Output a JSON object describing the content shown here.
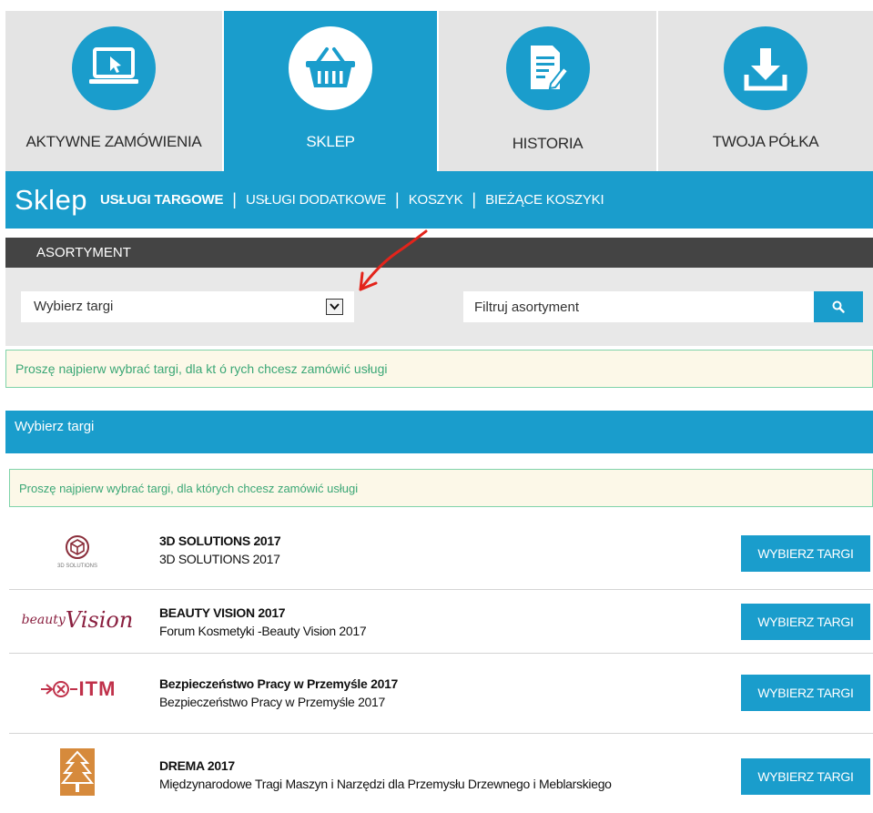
{
  "tiles": [
    {
      "label": "AKTYWNE ZAMÓWIENIA",
      "icon": "laptop-icon",
      "active": false
    },
    {
      "label": "SKLEP",
      "icon": "basket-icon",
      "active": true
    },
    {
      "label": "HISTORIA",
      "icon": "document-edit-icon",
      "active": false
    },
    {
      "label": "TWOJA PÓŁKA",
      "icon": "download-icon",
      "active": false
    }
  ],
  "shop_nav": {
    "title": "Sklep",
    "items": [
      {
        "label": "USŁUGI TARGOWE",
        "active": true
      },
      {
        "label": "USŁUGI DODATKOWE",
        "active": false
      },
      {
        "label": "KOSZYK",
        "active": false
      },
      {
        "label": "BIEŻĄCE KOSZYKI",
        "active": false
      }
    ],
    "separator": "|"
  },
  "assortment": {
    "heading": "ASORTYMENT",
    "select_value": "Wybierz targi",
    "filter_placeholder": "Filtruj asortyment"
  },
  "notice_top": "Proszę najpierw wybrać targi, dla kt ó rych chcesz zamówić usługi",
  "fair_section": {
    "heading": "Wybierz targi",
    "notice": "Proszę najpierw wybrać targi, dla których chcesz zamówić usługi",
    "button_label": "WYBIERZ TARGI",
    "fairs": [
      {
        "name": "3D SOLUTIONS 2017",
        "subtitle": "3D SOLUTIONS 2017",
        "logo_text": "3D SOLUTIONS"
      },
      {
        "name": "BEAUTY VISION 2017",
        "subtitle": "Forum Kosmetyki -Beauty Vision 2017",
        "logo_text_a": "beauty",
        "logo_text_b": "Vision"
      },
      {
        "name": "Bezpieczeństwo Pracy w Przemyśle 2017",
        "subtitle": "Bezpieczeństwo Pracy w Przemyśle 2017",
        "logo_text": "ITM"
      },
      {
        "name": "DREMA 2017",
        "subtitle": "Międzynarodowe Tragi Maszyn i Narzędzi dla Przemysłu Drzewnego i Meblarskiego"
      }
    ]
  },
  "colors": {
    "accent": "#1a9dcc",
    "tile_bg": "#e4e4e4",
    "dark_bar": "#444444",
    "notice_bg": "#fcf8e8",
    "notice_text": "#3ba776",
    "arrow": "#e3241b"
  }
}
